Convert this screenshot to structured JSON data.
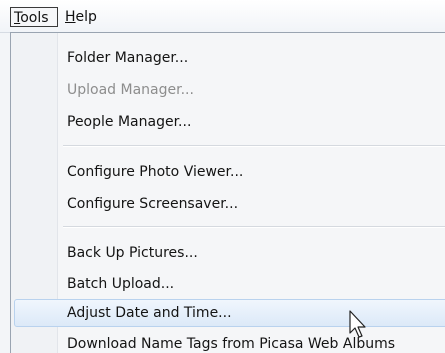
{
  "menubar": {
    "tools": {
      "mnemonic": "T",
      "rest": "ools"
    },
    "help": {
      "mnemonic": "H",
      "rest": "elp"
    }
  },
  "menu": {
    "items": [
      {
        "label": "Folder Manager...",
        "disabled": false
      },
      {
        "label": "Upload Manager...",
        "disabled": true
      },
      {
        "label": "People Manager...",
        "disabled": false
      },
      {
        "label": "Configure Photo Viewer...",
        "disabled": false
      },
      {
        "label": "Configure Screensaver...",
        "disabled": false
      },
      {
        "label": "Back Up Pictures...",
        "disabled": false
      },
      {
        "label": "Batch Upload...",
        "disabled": false
      },
      {
        "label": "Adjust Date and Time...",
        "disabled": false,
        "highlighted": true
      },
      {
        "label": "Download Name Tags from Picasa Web Albums",
        "disabled": false
      }
    ]
  },
  "cursor": {
    "icon": "arrow-cursor-icon"
  },
  "colors": {
    "highlight": "#dce9f8",
    "highlight_border": "#b9d2ee",
    "disabled_text": "#8d8d8d"
  }
}
